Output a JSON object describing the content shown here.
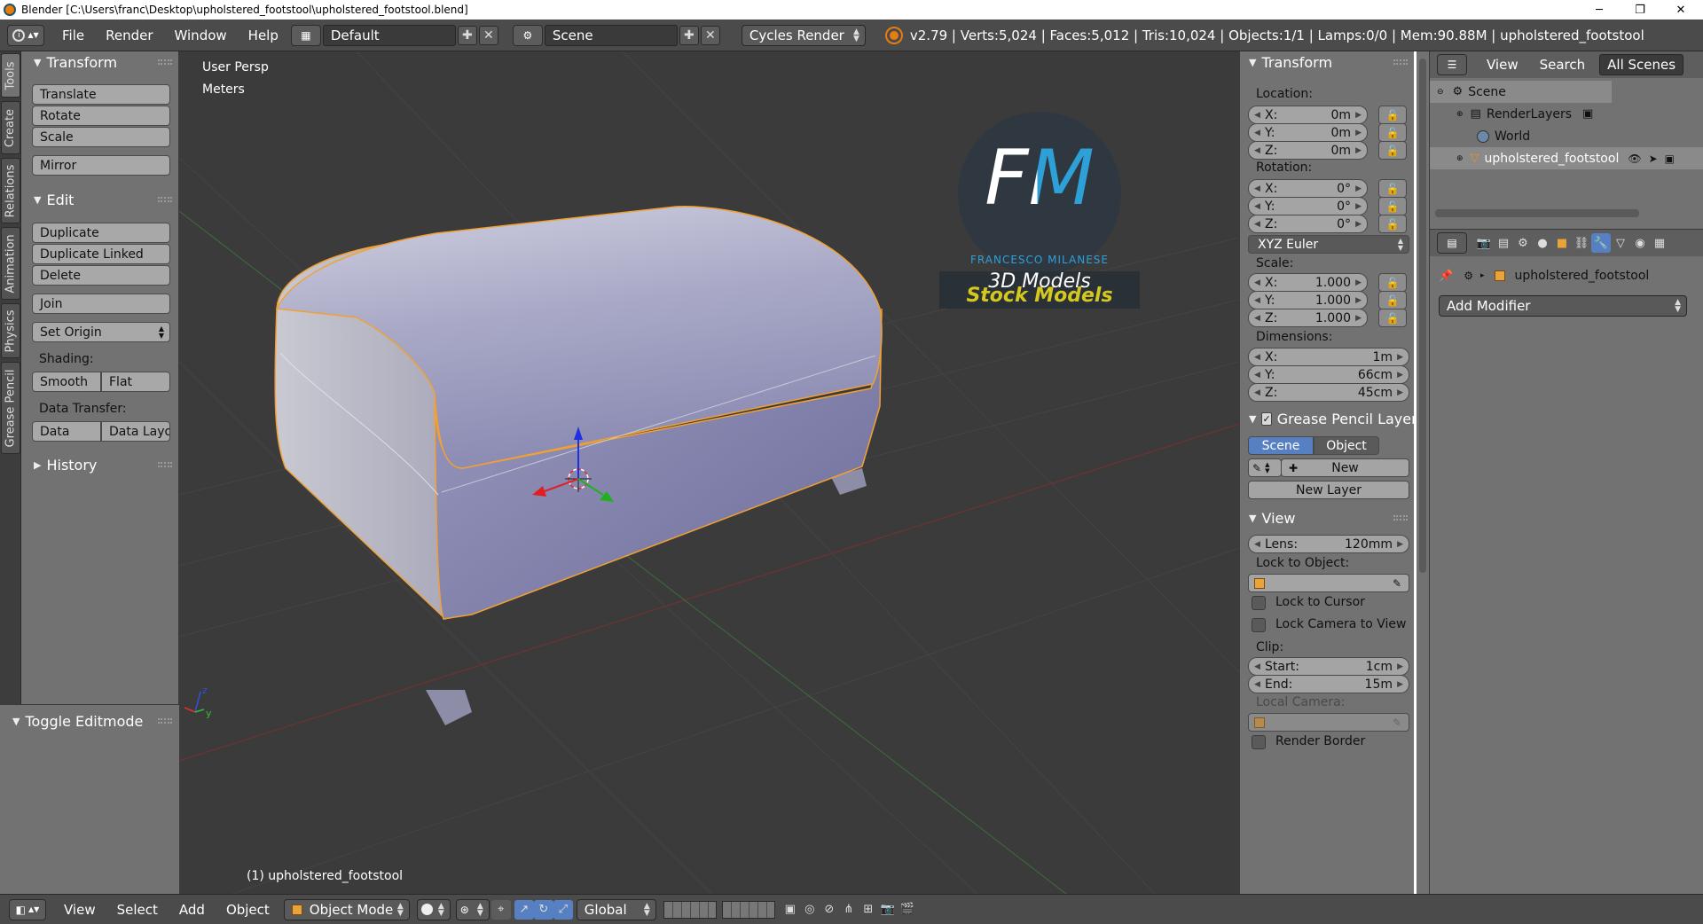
{
  "window": {
    "title": "Blender [C:\\Users\\franc\\Desktop\\upholstered_footstool\\upholstered_footstool.blend]"
  },
  "header": {
    "menus": [
      "File",
      "Render",
      "Window",
      "Help"
    ],
    "layout": "Default",
    "scene": "Scene",
    "engine": "Cycles Render",
    "stats": "v2.79 | Verts:5,024 | Faces:5,012 | Tris:10,024 | Objects:1/1 | Lamps:0/0 | Mem:90.88M | upholstered_footstool"
  },
  "tool_tabs": [
    "Tools",
    "Create",
    "Relations",
    "Animation",
    "Physics",
    "Grease Pencil"
  ],
  "tool_shelf": {
    "transform": {
      "title": "Transform",
      "buttons": [
        "Translate",
        "Rotate",
        "Scale",
        "Mirror"
      ]
    },
    "edit": {
      "title": "Edit",
      "buttons": [
        "Duplicate",
        "Duplicate Linked",
        "Delete",
        "Join"
      ],
      "set_origin": "Set Origin",
      "shading_label": "Shading:",
      "shading": [
        "Smooth",
        "Flat"
      ],
      "data_transfer_label": "Data Transfer:",
      "data_transfer": [
        "Data",
        "Data Layo"
      ]
    },
    "history": "History",
    "toggle_editmode": "Toggle Editmode"
  },
  "viewport": {
    "view_name": "User Persp",
    "units": "Meters",
    "object_label": "(1) upholstered_footstool",
    "watermark": {
      "initials": "FM",
      "name": "FRANCESCO MILANESE",
      "subtitle": "3D Models",
      "banner": "Stock Models"
    }
  },
  "n_panel": {
    "transform_title": "Transform",
    "location_label": "Location:",
    "location": [
      {
        "axis": "X:",
        "value": "0m"
      },
      {
        "axis": "Y:",
        "value": "0m"
      },
      {
        "axis": "Z:",
        "value": "0m"
      }
    ],
    "rotation_label": "Rotation:",
    "rotation": [
      {
        "axis": "X:",
        "value": "0°"
      },
      {
        "axis": "Y:",
        "value": "0°"
      },
      {
        "axis": "Z:",
        "value": "0°"
      }
    ],
    "rotation_mode": "XYZ Euler",
    "scale_label": "Scale:",
    "scale": [
      {
        "axis": "X:",
        "value": "1.000"
      },
      {
        "axis": "Y:",
        "value": "1.000"
      },
      {
        "axis": "Z:",
        "value": "1.000"
      }
    ],
    "dimensions_label": "Dimensions:",
    "dimensions": [
      {
        "axis": "X:",
        "value": "1m"
      },
      {
        "axis": "Y:",
        "value": "66cm"
      },
      {
        "axis": "Z:",
        "value": "45cm"
      }
    ],
    "grease_pencil_title": "Grease Pencil Layer",
    "gp_tabs": [
      "Scene",
      "Object"
    ],
    "gp_new": "New",
    "gp_new_layer": "New Layer",
    "view_title": "View",
    "lens_label": "Lens:",
    "lens_value": "120mm",
    "lock_to_object_label": "Lock to Object:",
    "lock_to_cursor": "Lock to Cursor",
    "lock_camera_to_view": "Lock Camera to View",
    "clip_label": "Clip:",
    "clip_start_label": "Start:",
    "clip_start": "1cm",
    "clip_end_label": "End:",
    "clip_end": "15m",
    "local_camera_label": "Local Camera:",
    "render_border": "Render Border"
  },
  "outliner": {
    "menus": [
      "View",
      "Search"
    ],
    "filter": "All Scenes",
    "items": [
      "Scene",
      "RenderLayers",
      "World",
      "upholstered_footstool"
    ]
  },
  "properties_editor": {
    "object_name": "upholstered_footstool",
    "add_modifier": "Add Modifier"
  },
  "bottom_bar": {
    "menus": [
      "View",
      "Select",
      "Add",
      "Object"
    ],
    "mode": "Object Mode",
    "orientation": "Global"
  },
  "colors": {
    "accent_blue": "#5680c2",
    "selection_orange": "#f1a033",
    "header_bg": "#4b4b4b",
    "panel_bg": "#727272",
    "viewport_bg": "#3b3b3b",
    "logo_blue": "#2ea0d8",
    "logo_yellow": "#d4c820"
  }
}
